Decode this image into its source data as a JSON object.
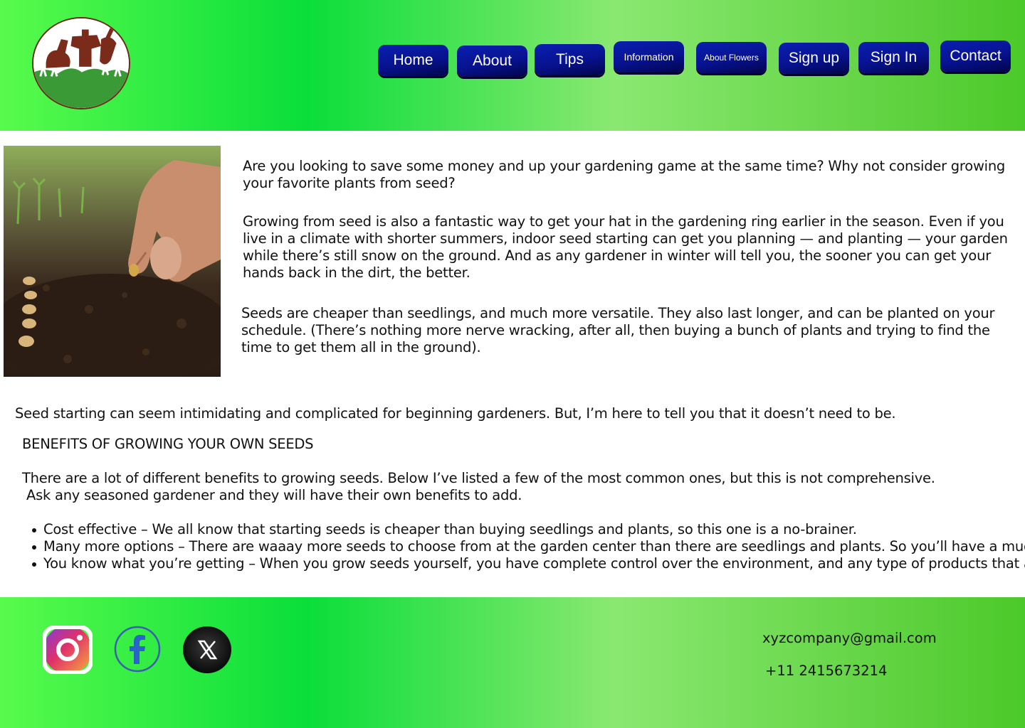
{
  "nav": {
    "home": "Home",
    "about": "About",
    "tips": "Tips",
    "information": "Information",
    "about_flowers": "About Flowers",
    "sign_up": "Sign up",
    "sign_in": "Sign In",
    "contact": "Contact"
  },
  "content": {
    "p1": "Are you looking to save some money and up your gardening game at the same time? Why not consider growing your favorite plants from seed?",
    "p2": "Growing from seed is also a fantastic way to get your hat in the gardening ring earlier in the season. Even if you live in a climate with shorter summers, indoor seed starting can get you planning — and planting — your garden while there’s still snow on the ground. And as any gardener in winter will tell you, the sooner you can get your hands back in the dirt, the better.",
    "p3": "Seeds are cheaper than seedlings, and much more versatile. They also last longer, and can be planted on your schedule. (There’s nothing more nerve wracking, after all, then buying a bunch of plants and trying to find the time to get them all in the ground).",
    "p4": "Seed starting can seem intimidating and complicated for beginning gardeners. But, I’m here to tell you that it doesn’t need to be.",
    "heading": "BENEFITS OF GROWING YOUR OWN SEEDS",
    "p5": "There are a lot of different benefits to growing seeds. Below I’ve listed a few of the most common ones, but this is not comprehensive.",
    "p6": "Ask any seasoned gardener and they will have their own benefits to add.",
    "bullets": [
      "Cost effective – We all know that starting seeds is cheaper than buying seedlings and plants, so this one is a no-brainer.",
      "Many more options – There are waaay more seeds to choose from at the garden center than there are seedlings and plants. So you’ll have a much",
      "You know what you’re getting – When you grow seeds yourself, you have complete control over the environment, and any type of products that are"
    ]
  },
  "footer": {
    "email": "xyzcompany@gmail.com",
    "phone": "+11 2415673214"
  },
  "icons": {
    "logo": "garden-tools-logo",
    "instagram": "instagram-icon",
    "facebook": "facebook-icon",
    "x": "x-icon"
  },
  "colors": {
    "band_gradient": [
      "#58fb4c",
      "#0ade3a",
      "#8ae871",
      "#4cc92a"
    ],
    "nav_button": "#07128f"
  }
}
